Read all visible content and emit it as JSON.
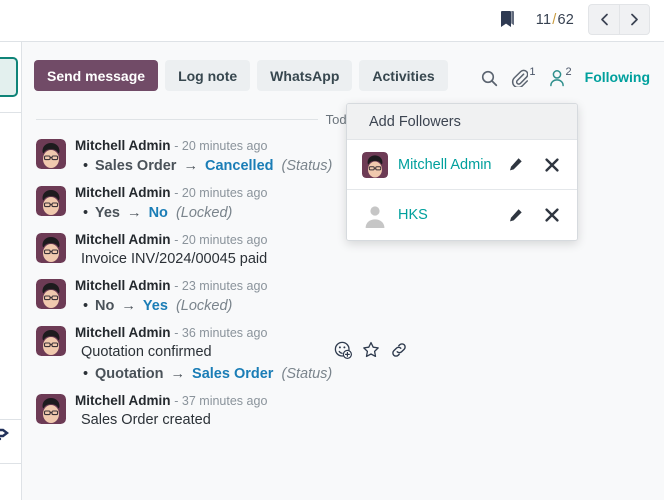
{
  "header": {
    "bookmark_icon": "bookmark-icon",
    "pager": {
      "current": "11",
      "separator": "/",
      "total": "62"
    },
    "prev_label": "‹",
    "next_label": "›"
  },
  "composer": {
    "buttons": [
      {
        "label": "Send message",
        "name": "send-message-button",
        "style": "primary"
      },
      {
        "label": "Log note",
        "name": "log-note-button",
        "style": "ghost"
      },
      {
        "label": "WhatsApp",
        "name": "whatsapp-button",
        "style": "ghost"
      },
      {
        "label": "Activities",
        "name": "activities-button",
        "style": "ghost"
      }
    ],
    "search_icon": "search-icon",
    "attachment_icon": "paperclip-icon",
    "attachment_count": "1",
    "followers_icon": "user-icon",
    "followers_count": "2",
    "following_label": "Following",
    "following_color": "#00a09d"
  },
  "thread": {
    "day_label": "Today",
    "messages": [
      {
        "author": "Mitchell Admin",
        "timestamp": "- 20 minutes ago",
        "text": "",
        "tracking": {
          "old": "Sales Order",
          "arrow": "→",
          "new": "Cancelled",
          "field": "(Status)"
        }
      },
      {
        "author": "Mitchell Admin",
        "timestamp": "- 20 minutes ago",
        "text": "",
        "tracking": {
          "old": "Yes",
          "arrow": "→",
          "new": "No",
          "field": "(Locked)"
        }
      },
      {
        "author": "Mitchell Admin",
        "timestamp": "- 20 minutes ago",
        "text": "Invoice INV/2024/00045 paid",
        "tracking": null
      },
      {
        "author": "Mitchell Admin",
        "timestamp": "- 23 minutes ago",
        "text": "",
        "tracking": {
          "old": "No",
          "arrow": "→",
          "new": "Yes",
          "field": "(Locked)"
        }
      },
      {
        "author": "Mitchell Admin",
        "timestamp": "- 36 minutes ago",
        "text": "Quotation confirmed",
        "tracking": {
          "old": "Quotation",
          "arrow": "→",
          "new": "Sales Order",
          "field": "(Status)"
        }
      },
      {
        "author": "Mitchell Admin",
        "timestamp": "- 37 minutes ago",
        "text": "Sales Order created",
        "tracking": null
      }
    ],
    "hover_actions": [
      {
        "name": "add-reaction-icon"
      },
      {
        "name": "mark-todo-star-icon"
      },
      {
        "name": "copy-link-icon"
      }
    ]
  },
  "followers_dropdown": {
    "add_followers_label": "Add Followers",
    "rows": [
      {
        "name": "Mitchell Admin",
        "avatar": "mitchell-avatar",
        "edit_icon": "pencil-icon",
        "remove_icon": "close-icon"
      },
      {
        "name": "HKS",
        "avatar": "generic-avatar",
        "edit_icon": "pencil-icon",
        "remove_icon": "close-icon"
      }
    ]
  },
  "colors": {
    "primary": "#714b67",
    "accent_teal": "#00a09d",
    "link_blue": "#1a7db6",
    "page_bg": "#f8f9fa"
  }
}
